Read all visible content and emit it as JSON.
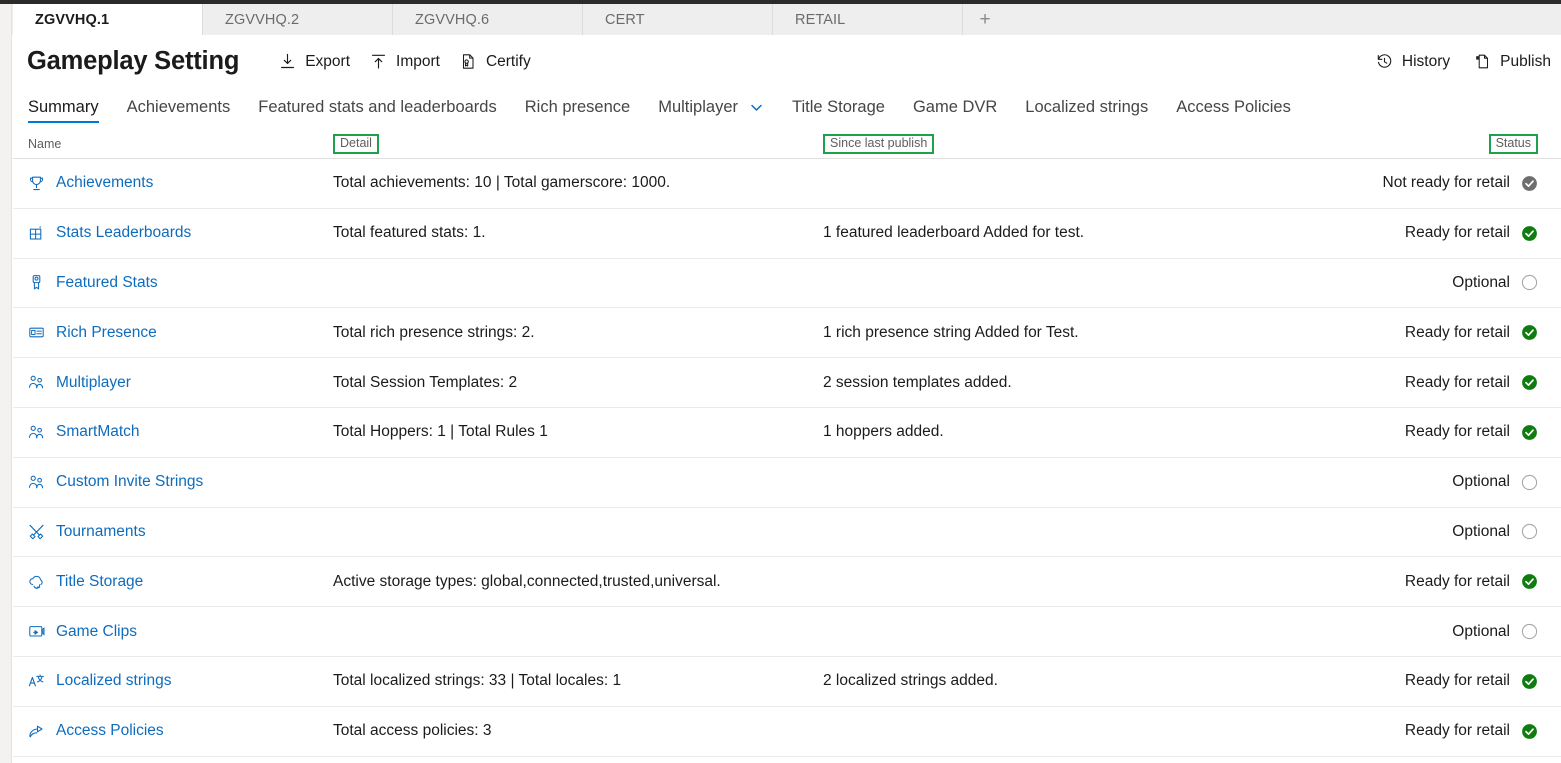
{
  "browser_tabs": [
    {
      "label": "ZGVVHQ.1",
      "active": true
    },
    {
      "label": "ZGVVHQ.2",
      "active": false
    },
    {
      "label": "ZGVVHQ.6",
      "active": false
    },
    {
      "label": "CERT",
      "active": false
    },
    {
      "label": "RETAIL",
      "active": false
    }
  ],
  "new_tab_label": "+",
  "header": {
    "title": "Gameplay Setting",
    "commands": [
      {
        "label": "Export",
        "icon": "download-icon"
      },
      {
        "label": "Import",
        "icon": "upload-icon"
      },
      {
        "label": "Certify",
        "icon": "certificate-icon"
      }
    ],
    "right_commands": [
      {
        "label": "History",
        "icon": "history-icon"
      },
      {
        "label": "Publish",
        "icon": "publish-page-icon"
      }
    ]
  },
  "nav_tabs": [
    {
      "label": "Summary",
      "active": true,
      "chevron": false
    },
    {
      "label": "Achievements",
      "active": false,
      "chevron": false
    },
    {
      "label": "Featured stats and leaderboards",
      "active": false,
      "chevron": false
    },
    {
      "label": "Rich presence",
      "active": false,
      "chevron": false
    },
    {
      "label": "Multiplayer",
      "active": false,
      "chevron": true
    },
    {
      "label": "Title Storage",
      "active": false,
      "chevron": false
    },
    {
      "label": "Game DVR",
      "active": false,
      "chevron": false
    },
    {
      "label": "Localized strings",
      "active": false,
      "chevron": false
    },
    {
      "label": "Access Policies",
      "active": false,
      "chevron": false
    }
  ],
  "table": {
    "columns": {
      "name": {
        "label": "Name",
        "highlighted": false
      },
      "detail": {
        "label": "Detail",
        "highlighted": true
      },
      "since_last_publish": {
        "label": "Since last publish",
        "highlighted": true
      },
      "status": {
        "label": "Status",
        "highlighted": true
      }
    },
    "highlight_color": "#21a04a",
    "status_colors": {
      "ready": "#107c10",
      "not_ready": "#6e6e6e",
      "optional": "#ffffff"
    },
    "rows": [
      {
        "name": "Achievements",
        "icon": "trophy-icon",
        "detail": "Total achievements: 10 | Total gamerscore: 1000.",
        "since_last_publish": "",
        "status": "Not ready for retail",
        "status_type": "not_ready"
      },
      {
        "name": "Stats Leaderboards",
        "icon": "leaderboard-grid-icon",
        "detail": "Total featured stats: 1.",
        "since_last_publish": "1 featured leaderboard Added for test.",
        "status": "Ready for retail",
        "status_type": "ready"
      },
      {
        "name": "Featured Stats",
        "icon": "ribbon-award-icon",
        "detail": "",
        "since_last_publish": "",
        "status": "Optional",
        "status_type": "optional"
      },
      {
        "name": "Rich Presence",
        "icon": "id-card-icon",
        "detail": "Total rich presence strings: 2.",
        "since_last_publish": "1 rich presence string Added for Test.",
        "status": "Ready for retail",
        "status_type": "ready"
      },
      {
        "name": "Multiplayer",
        "icon": "people-icon",
        "detail": "Total Session Templates: 2",
        "since_last_publish": "2 session templates added.",
        "status": "Ready for retail",
        "status_type": "ready"
      },
      {
        "name": "SmartMatch",
        "icon": "people-icon",
        "detail": "Total Hoppers: 1 | Total Rules 1",
        "since_last_publish": "1 hoppers added.",
        "status": "Ready for retail",
        "status_type": "ready"
      },
      {
        "name": "Custom Invite Strings",
        "icon": "people-icon",
        "detail": "",
        "since_last_publish": "",
        "status": "Optional",
        "status_type": "optional"
      },
      {
        "name": "Tournaments",
        "icon": "crossed-swords-icon",
        "detail": "",
        "since_last_publish": "",
        "status": "Optional",
        "status_type": "optional"
      },
      {
        "name": "Title Storage",
        "icon": "cloud-sync-icon",
        "detail": "Active storage types: global,connected,trusted,universal.",
        "since_last_publish": "",
        "status": "Ready for retail",
        "status_type": "ready"
      },
      {
        "name": "Game Clips",
        "icon": "video-clip-icon",
        "detail": "",
        "since_last_publish": "",
        "status": "Optional",
        "status_type": "optional"
      },
      {
        "name": "Localized strings",
        "icon": "translate-icon",
        "detail": "Total localized strings: 33 | Total locales: 1",
        "since_last_publish": "2 localized strings added.",
        "status": "Ready for retail",
        "status_type": "ready"
      },
      {
        "name": "Access Policies",
        "icon": "share-arrow-icon",
        "detail": "Total access policies: 3",
        "since_last_publish": "",
        "status": "Ready for retail",
        "status_type": "ready"
      }
    ]
  }
}
